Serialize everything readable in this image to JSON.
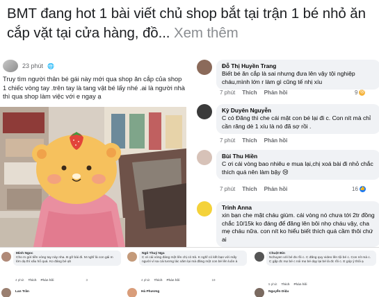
{
  "headline": {
    "text": "BMT đang hot 1 bài viết chủ shop bắt tại trận 1 bé nhỏ ăn cắp vặt tại cửa hàng, đồ...",
    "more": "Xem thêm"
  },
  "post": {
    "time": "23 phút",
    "text": "Truy tìm người thân bé gái này mới qua shop ăn cắp của shop 1 chiếc vòng tay .trên tay là tang vật bé lấy nhé .ai là người nhà thì qua shop làm việc với e ngay ạ"
  },
  "comments": [
    {
      "name": "Đỗ Thị Huyền Trang",
      "text": "Biết bé ăn cắp là sai nhưng đưa lên vậy tội nghiệp cháu,mình lớn r làm gì cũng tế nhị xíu",
      "time": "7 phút",
      "like": "Thích",
      "reply": "Phản hồi",
      "count": "9",
      "avatar": "#8b6a5a"
    },
    {
      "name": "Kỳ Duyên Nguyễn",
      "text": "C có Đăng thì che cái mặt con bé lại đi c. Con nít mà chỉ cần răng dè 1 xíu là nó đã sợ rồi .",
      "time": "7 phút",
      "like": "Thích",
      "reply": "Phản hồi",
      "count": "",
      "avatar": "#3a3a3a"
    },
    {
      "name": "Bùi Thu Hiền",
      "text": "C ơi cái vòng bao nhiêu e mua lại,chị xoá bài đi nhỏ chắc thích quá nên làm bậy 😢",
      "time": "7 phút",
      "like": "Thích",
      "reply": "Phản hồi",
      "count": "16",
      "avatar": "#d7c2b8"
    },
    {
      "name": "Trinh Anna",
      "text": "xin bạn che mặt cháu giùm. cái vòng nó chưa tới 2tr đồng chắc 10/15k ko đáng để đăng lên bôi nhọ cháu vậy, cha mẹ cháu nữa. con nít ko hiểu biết thích quá cầm thôi chứ ai",
      "time": "",
      "like": "",
      "reply": "",
      "count": "",
      "avatar": "#f4d23a"
    }
  ],
  "strip": [
    {
      "name": "Minh Ngoc",
      "text": "Cho m gửi tiền vòng tay này nha. B gỡ bài đi. M nghĩ là con gái m lớn dạ thì xấu hổ quá. Ko đáng bé ạh",
      "time": "4 phút",
      "like": "Thích",
      "reply": "Phản hồi",
      "count": "3",
      "avatar": "#b08a78"
    },
    {
      "name": "Ngô Thuý Nga",
      "text": "C ơi cái vòng đáng một lên chị cỏ trả. K nghĩ có kết bạn với mấy người vì sa cái tương lác xăm lại mà đăng một con bé lên luôn à",
      "time": "4 phút",
      "like": "Thích",
      "reply": "Phản hồi",
      "count": "19",
      "avatar": "#c49a7a"
    },
    {
      "name": "Chuột Bin",
      "text": "Nchuyen với bé đx rồi c. C đăng quy video lên tội bé c. Con nít mà c. C gặp đc mẹ bé c nói mẹ bé dạy lại bé là đc rồi c. E góp ý thôi ạ",
      "time": "5 phút",
      "like": "Thích",
      "reply": "Phản hồi",
      "count": "",
      "avatar": "#555555"
    }
  ],
  "strip_names_row2": [
    "Lan Trần",
    "Hà Phương",
    "Nguyễn Diệu"
  ]
}
